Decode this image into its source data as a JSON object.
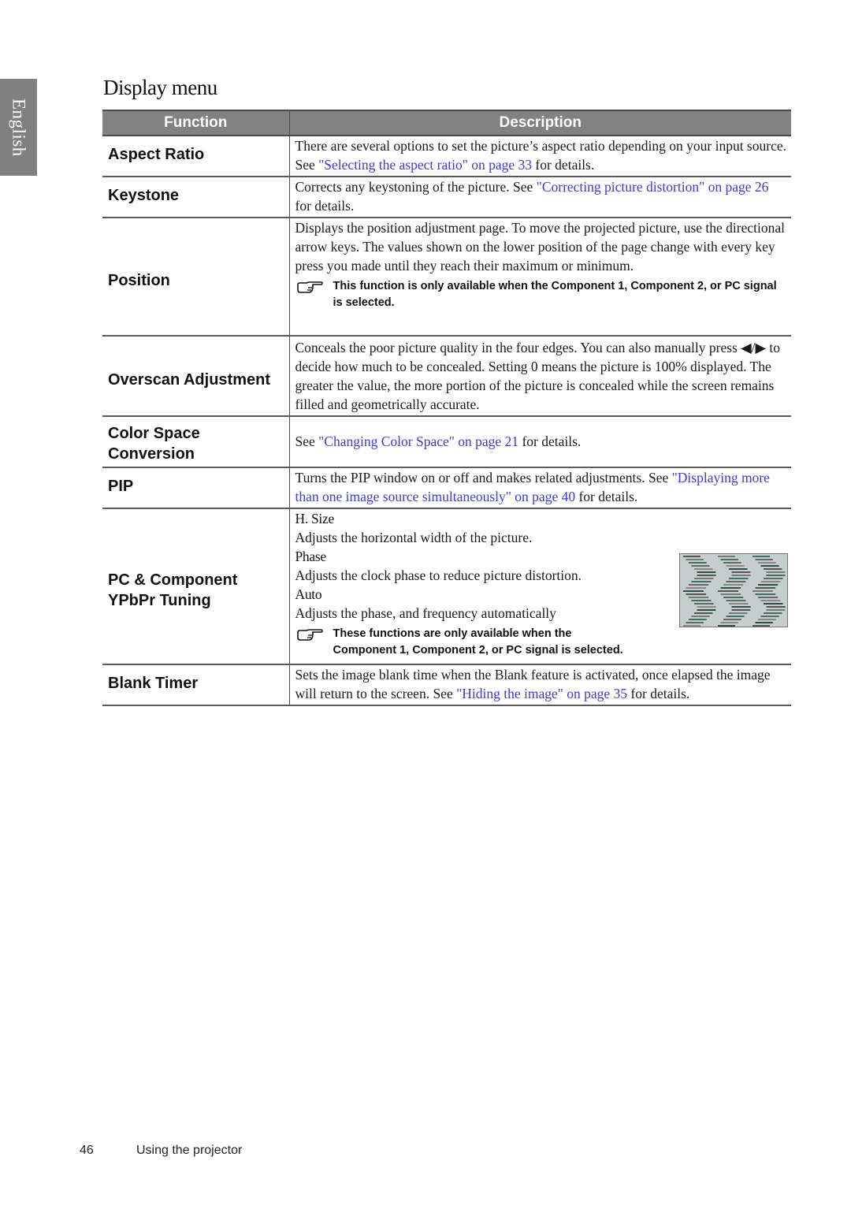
{
  "sidebar": {
    "language_tab": "English"
  },
  "page": {
    "title": "Display menu"
  },
  "table": {
    "headers": {
      "function": "Function",
      "description": "Description"
    },
    "rows": [
      {
        "function": "Aspect Ratio",
        "desc_pre": "There are several options to set the picture’s aspect ratio depending on your input source. See ",
        "link": "\"Selecting the aspect ratio\" on page 33",
        "desc_post": " for details."
      },
      {
        "function": "Keystone",
        "desc_pre": "Corrects any keystoning of the picture. See ",
        "link": "\"Correcting picture distortion\" on page 26",
        "desc_post": " for details."
      },
      {
        "function": "Position",
        "desc": "Displays the position adjustment page. To move the projected picture, use the directional arrow keys. The values shown on the lower position of the page change with every key press you made until they reach their maximum or minimum.",
        "note": "This function is only available when the Component 1, Component 2, or PC signal is selected."
      },
      {
        "function": "Overscan Adjustment",
        "desc_pre": "Conceals the poor picture quality in the four edges. You can also manually press ",
        "arrows": "◀/▶",
        "desc_post": " to decide how much to be concealed. Setting 0 means the picture is 100% displayed. The greater the value, the more portion of the picture is concealed while the screen remains filled and geometrically accurate."
      },
      {
        "function_line1": "Color Space",
        "function_line2": "Conversion",
        "desc_pre": "See ",
        "link": "\"Changing Color Space\" on page 21",
        "desc_post": " for details."
      },
      {
        "function": "PIP",
        "desc_pre": "Turns the PIP window on or off and makes related adjustments. See ",
        "link": "\"Displaying more than one image source simultaneously\" on page 40",
        "desc_post": " for details."
      },
      {
        "function_line1": "PC & Component",
        "function_line2": "YPbPr Tuning",
        "items": [
          {
            "title": "H. Size",
            "text": "Adjusts the horizontal width of the picture."
          },
          {
            "title": "Phase",
            "text": "Adjusts the clock phase to reduce picture distortion."
          },
          {
            "title": "Auto",
            "text": "Adjusts the phase, and frequency automatically"
          }
        ],
        "image_label": "phase-distortion-illustration",
        "note_line1": "These functions are only available when the",
        "note_line2": "Component 1, Component 2, or PC signal is selected."
      },
      {
        "function": "Blank Timer",
        "desc_pre": "Sets the image blank time when the Blank feature is activated, once elapsed the image will return to the screen. See ",
        "link": "\"Hiding the image\" on page 35",
        "desc_post": " for details."
      }
    ]
  },
  "footer": {
    "page_number": "46",
    "section": "Using the projector"
  },
  "colors": {
    "header_bg": "#828282",
    "link": "#3b3bd9",
    "lang_tab_bg": "#808080"
  }
}
